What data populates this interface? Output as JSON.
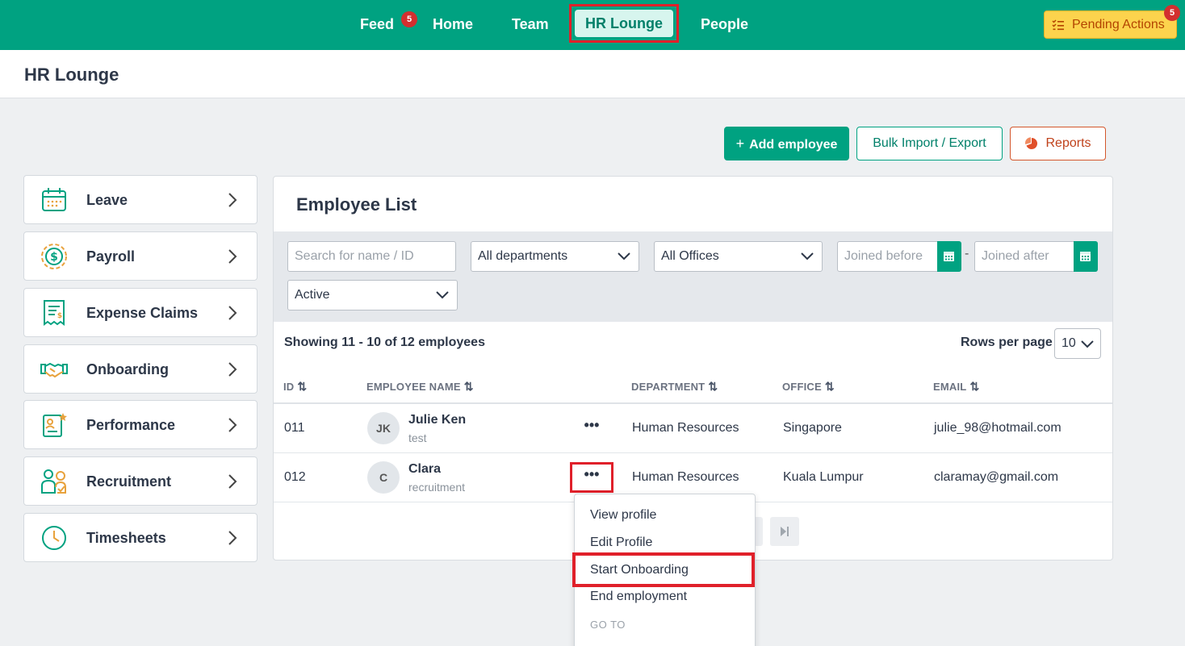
{
  "nav": {
    "items": [
      {
        "label": "Feed",
        "badge": "5"
      },
      {
        "label": "Home"
      },
      {
        "label": "Team"
      },
      {
        "label": "HR Lounge",
        "active": true
      },
      {
        "label": "People"
      }
    ],
    "pending_actions": {
      "label": "Pending Actions",
      "badge": "5"
    }
  },
  "header": {
    "title": "HR Lounge"
  },
  "actions": {
    "add_employee": "Add employee",
    "bulk": "Bulk Import / Export",
    "reports": "Reports"
  },
  "sidebar": {
    "items": [
      {
        "label": "Leave",
        "icon": "calendar-icon"
      },
      {
        "label": "Payroll",
        "icon": "dollar-coin-icon"
      },
      {
        "label": "Expense Claims",
        "icon": "receipt-icon"
      },
      {
        "label": "Onboarding",
        "icon": "handshake-icon"
      },
      {
        "label": "Performance",
        "icon": "performance-icon"
      },
      {
        "label": "Recruitment",
        "icon": "people-icon"
      },
      {
        "label": "Timesheets",
        "icon": "clock-icon"
      }
    ]
  },
  "employee_list": {
    "title": "Employee List",
    "filters": {
      "search_placeholder": "Search for name / ID",
      "department": "All departments",
      "office": "All Offices",
      "joined_before_placeholder": "Joined before",
      "joined_after_placeholder": "Joined after",
      "range_separator": "-",
      "status": "Active"
    },
    "showing": "Showing 11 - 10 of 12 employees",
    "rows_per_page_label": "Rows per page",
    "rows_per_page_value": "10",
    "columns": [
      "ID",
      "EMPLOYEE NAME",
      "DEPARTMENT",
      "OFFICE",
      "EMAIL"
    ],
    "rows": [
      {
        "id": "011",
        "initials": "JK",
        "name": "Julie Ken",
        "sub": "test",
        "department": "Human Resources",
        "office": "Singapore",
        "email": "julie_98@hotmail.com"
      },
      {
        "id": "012",
        "initials": "C",
        "name": "Clara",
        "sub": "recruitment",
        "department": "Human Resources",
        "office": "Kuala Lumpur",
        "email": "claramay@gmail.com"
      }
    ]
  },
  "row_menu": {
    "items": [
      "View profile",
      "Edit Profile",
      "Start Onboarding",
      "End employment"
    ],
    "section": "GO TO"
  },
  "colors": {
    "brand": "#00a281",
    "highlight": "#e0202a",
    "pending": "#fcd34d"
  }
}
